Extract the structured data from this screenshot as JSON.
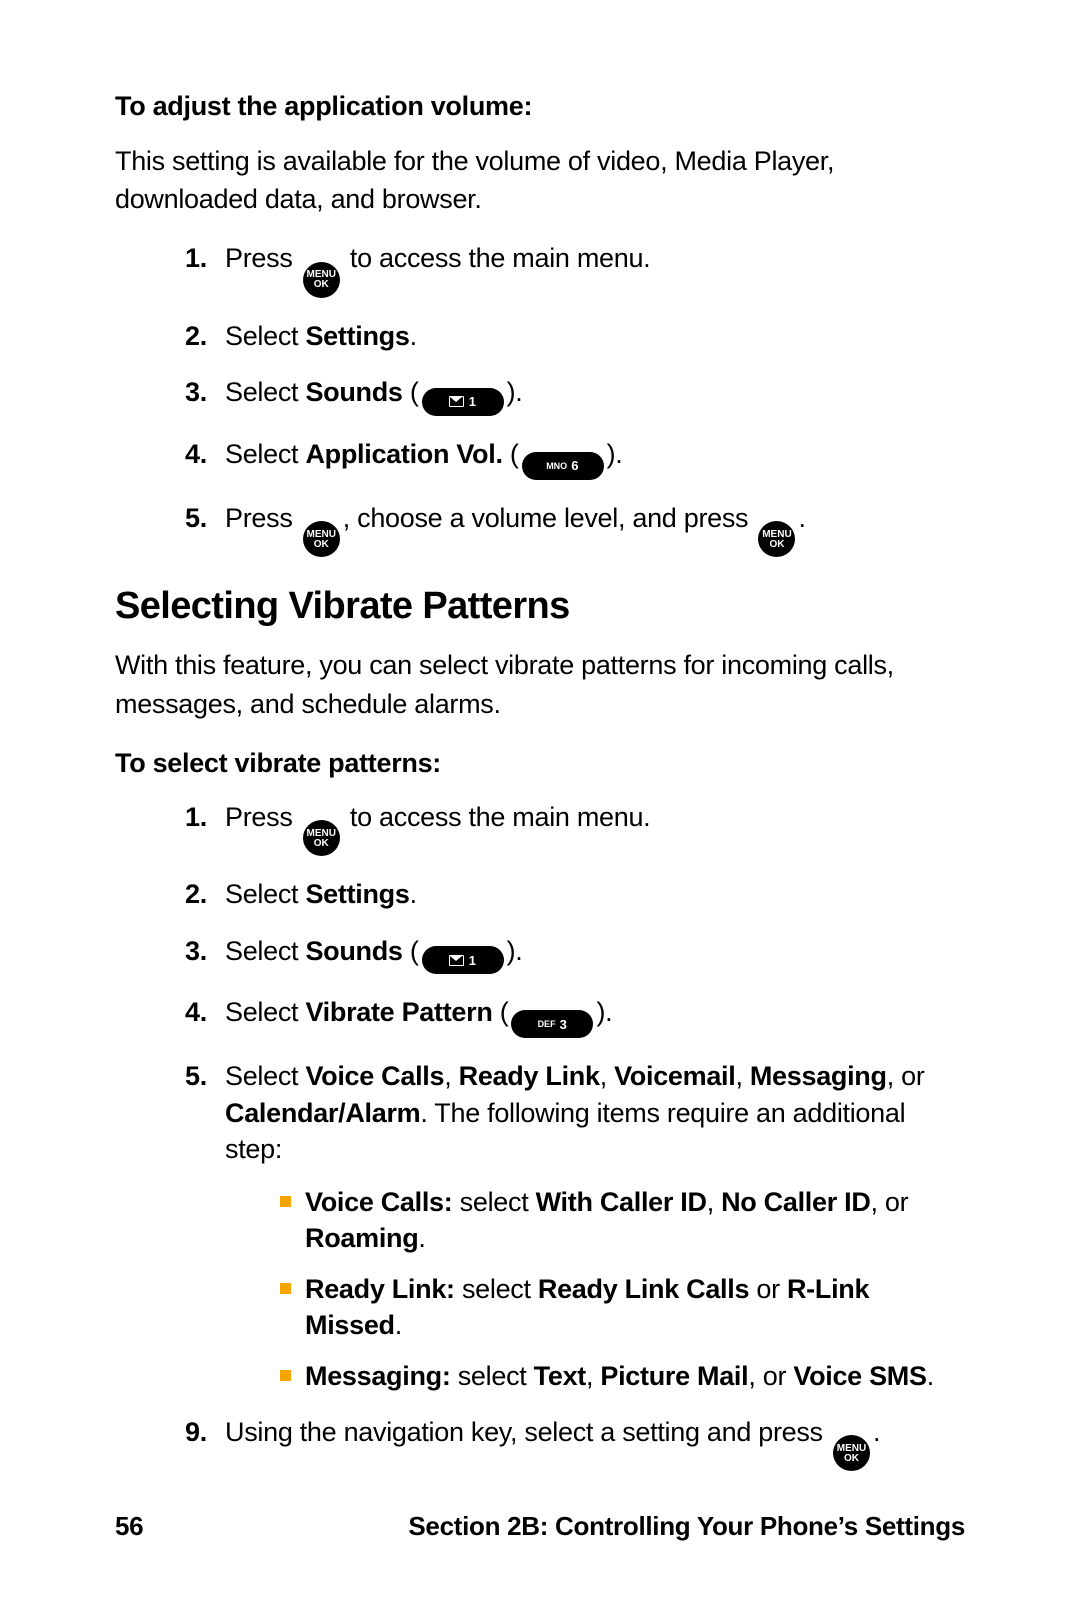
{
  "sectionA": {
    "subhead": "To adjust the application volume:",
    "intro": "This setting is available for the volume of video, Media Player, downloaded data, and browser.",
    "steps": {
      "s1a": "Press ",
      "s1b": " to access the main menu.",
      "s2a": "Select ",
      "s2b": "Settings",
      "s2c": ".",
      "s3a": "Select ",
      "s3b": "Sounds",
      "s3c": " (",
      "s3d": ").",
      "s4a": "Select ",
      "s4b": "Application Vol.",
      "s4c": " (",
      "s4d": ").",
      "s5a": "Press ",
      "s5b": ", choose a volume level, and press ",
      "s5c": "."
    }
  },
  "heading": "Selecting Vibrate Patterns",
  "sectionB": {
    "intro": "With this feature, you can select vibrate patterns for incoming calls, messages, and schedule alarms.",
    "subhead": "To select vibrate patterns:",
    "steps": {
      "s1a": "Press ",
      "s1b": " to access the main menu.",
      "s2a": "Select ",
      "s2b": "Settings",
      "s2c": ".",
      "s3a": "Select ",
      "s3b": "Sounds",
      "s3c": " (",
      "s3d": ").",
      "s4a": "Select ",
      "s4b": "Vibrate Pattern",
      "s4c": " (",
      "s4d": ").",
      "s5a": "Select ",
      "s5b": "Voice Calls",
      "s5c": ", ",
      "s5d": "Ready Link",
      "s5e": ", ",
      "s5f": "Voicemail",
      "s5g": ", ",
      "s5h": "Messaging",
      "s5i": ", or ",
      "s5j": "Calendar/Alarm",
      "s5k": ". The following items require an additional step:",
      "sub1a": "Voice Calls:",
      "sub1b": " select ",
      "sub1c": "With Caller ID",
      "sub1d": ", ",
      "sub1e": "No Caller ID",
      "sub1f": ", or ",
      "sub1g": "Roaming",
      "sub1h": ".",
      "sub2a": "Ready Link:",
      "sub2b": " select ",
      "sub2c": "Ready Link Calls",
      "sub2d": " or ",
      "sub2e": "R-Link Missed",
      "sub2f": ".",
      "sub3a": "Messaging:",
      "sub3b": " select ",
      "sub3c": "Text",
      "sub3d": ", ",
      "sub3e": "Picture Mail",
      "sub3f": ", or ",
      "sub3g": "Voice SMS",
      "sub3h": ".",
      "s6a": "Using the navigation key, select a setting and press ",
      "s6b": "."
    }
  },
  "keys": {
    "menuTop": "MENU",
    "menuBot": "OK",
    "one": "1",
    "six": "6",
    "three": "3",
    "mno": "MNO",
    "def": "DEF"
  },
  "footer": {
    "page": "56",
    "section": "Section 2B: Controlling Your Phone’s Settings"
  }
}
